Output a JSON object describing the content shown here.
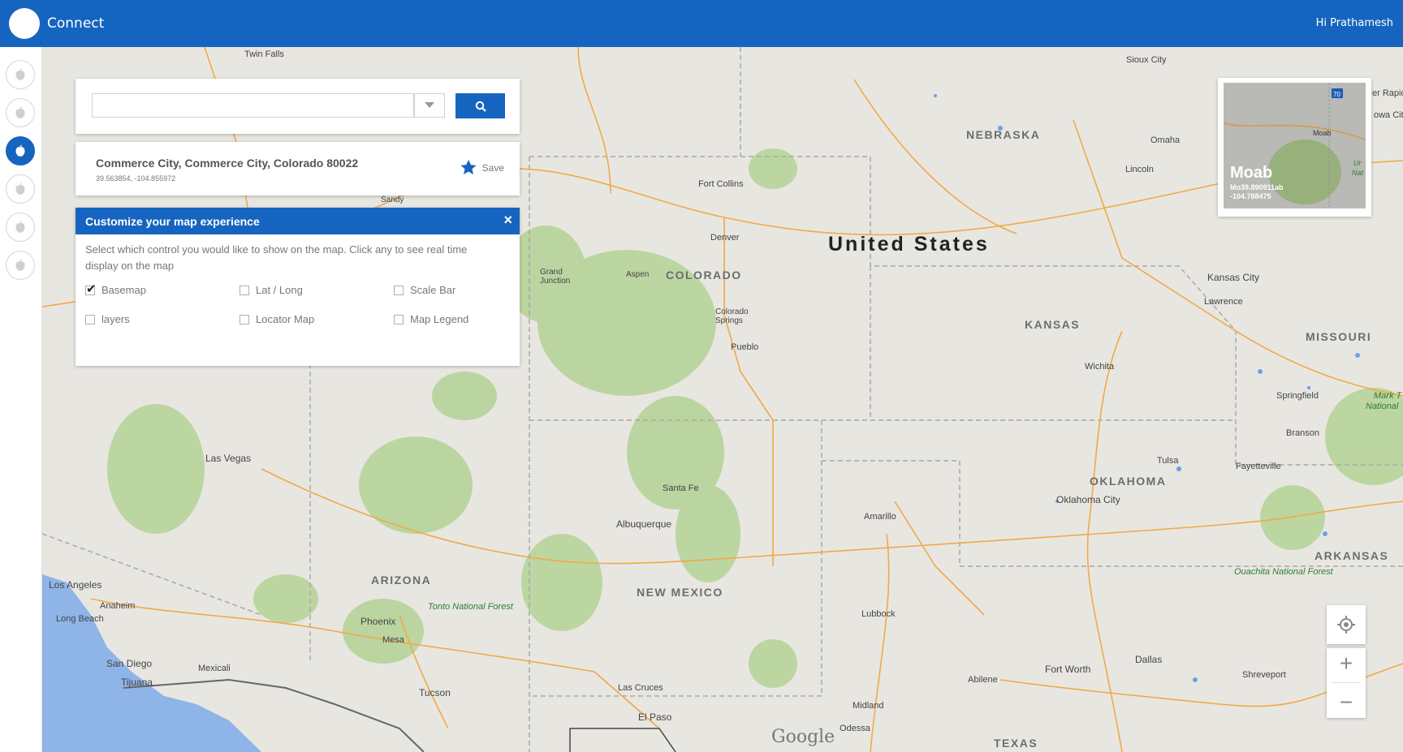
{
  "header": {
    "app_title": "Connect",
    "greeting": "Hi Prathamesh"
  },
  "rail": {
    "items": [
      {
        "icon": "apple-icon",
        "active": false
      },
      {
        "icon": "apple-icon",
        "active": false
      },
      {
        "icon": "apple-icon",
        "active": true
      },
      {
        "icon": "apple-icon",
        "active": false
      },
      {
        "icon": "apple-icon",
        "active": false
      },
      {
        "icon": "apple-icon",
        "active": false
      }
    ]
  },
  "search": {
    "value": "",
    "placeholder": "",
    "dropdown_icon": "caret-down-icon",
    "button_icon": "search-icon"
  },
  "result": {
    "title": "Commerce City, Commerce City, Colorado 80022",
    "coords": "39.563854, -104.855972",
    "save_label": "Save",
    "save_icon": "star-icon"
  },
  "customize": {
    "title": "Customize your map experience",
    "close": "×",
    "description": "Select which control you would like to show on the map. Click any to see real time display on the map",
    "options": [
      {
        "label": "Basemap",
        "checked": true
      },
      {
        "label": "Lat / Long",
        "checked": false
      },
      {
        "label": "Scale Bar",
        "checked": false
      },
      {
        "label": "layers",
        "checked": false
      },
      {
        "label": "Locator Map",
        "checked": false
      },
      {
        "label": "Map Legend",
        "checked": false
      }
    ]
  },
  "locator": {
    "name": "Moab",
    "coords": "Mo39.890911ab -104.788475",
    "inner_label": "Moab",
    "highway": "70",
    "edge_labels": [
      "Ur",
      "Nat"
    ]
  },
  "controls": {
    "locate_icon": "crosshair-icon",
    "zoom_in": "+",
    "zoom_out": "−"
  },
  "map": {
    "country": "United States",
    "states": [
      "NEBRASKA",
      "COLORADO",
      "KANSAS",
      "MISSOURI",
      "OKLAHOMA",
      "ARKANSAS",
      "ARIZONA",
      "NEW MEXICO",
      "TEXAS"
    ],
    "cities": [
      "Twin Falls",
      "Sioux City",
      "Omaha",
      "Lincoln",
      "Fort Collins",
      "Denver",
      "Grand Junction",
      "Aspen",
      "Colorado Springs",
      "Pueblo",
      "Kansas City",
      "Lawrence",
      "Wichita",
      "Springfield",
      "Branson",
      "Tulsa",
      "Fayetteville",
      "Oklahoma City",
      "Las Vegas",
      "Santa Fe",
      "Albuquerque",
      "Amarillo",
      "Los Angeles",
      "Anaheim",
      "Long Beach",
      "Phoenix",
      "Mesa",
      "San Diego",
      "Tijuana",
      "Mexicali",
      "Tucson",
      "Las Cruces",
      "El Paso",
      "Lubbock",
      "Midland",
      "Odessa",
      "Abilene",
      "Fort Worth",
      "Dallas",
      "Shreveport",
      "Sandy",
      "er Rapids",
      "owa City",
      "Mark T",
      "National"
    ],
    "parks": [
      "Tonto National Forest",
      "Ouachita National Forest"
    ],
    "attribution": "Google"
  }
}
